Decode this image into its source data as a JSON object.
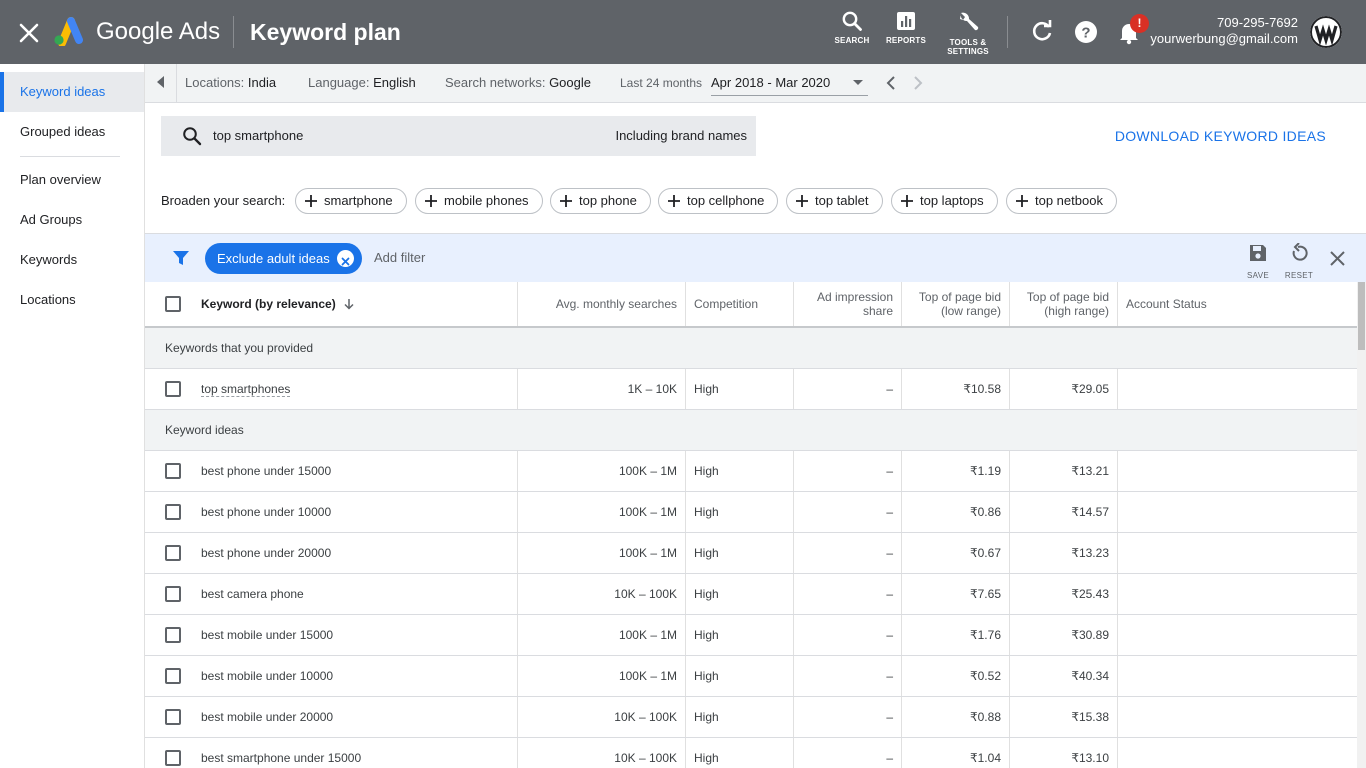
{
  "header": {
    "brand": "Google Ads",
    "page_title": "Keyword plan",
    "tools": [
      {
        "label": "SEARCH",
        "icon": "search-icon"
      },
      {
        "label": "REPORTS",
        "icon": "reports-icon"
      },
      {
        "label": "TOOLS &\nSETTINGS",
        "icon": "wrench-icon"
      }
    ],
    "notification_badge": "!",
    "account_phone": "709-295-7692",
    "account_email": "yourwerbung@gmail.com"
  },
  "sidebar": {
    "items": [
      {
        "label": "Keyword ideas",
        "active": true
      },
      {
        "label": "Grouped ideas"
      },
      {
        "label": "Plan overview"
      },
      {
        "label": "Ad Groups"
      },
      {
        "label": "Keywords"
      },
      {
        "label": "Locations"
      }
    ]
  },
  "strip": {
    "locations_label": "Locations:",
    "locations_value": "India",
    "language_label": "Language:",
    "language_value": "English",
    "networks_label": "Search networks:",
    "networks_value": "Google",
    "period_label": "Last 24 months",
    "date_range": "Apr 2018 - Mar 2020"
  },
  "search": {
    "query": "top smartphone",
    "brand_note": "Including brand names",
    "download_label": "DOWNLOAD KEYWORD IDEAS",
    "broaden_label": "Broaden your search:",
    "broaden_chips": [
      "smartphone",
      "mobile phones",
      "top phone",
      "top cellphone",
      "top tablet",
      "top laptops",
      "top netbook"
    ]
  },
  "filterbar": {
    "exclude_label": "Exclude adult ideas",
    "add_filter_label": "Add filter",
    "save_label": "SAVE",
    "reset_label": "RESET"
  },
  "table": {
    "headers": {
      "keyword": "Keyword (by relevance)",
      "searches": "Avg. monthly searches",
      "competition": "Competition",
      "impression": "Ad impression share",
      "bid_low": "Top of page bid (low range)",
      "bid_high": "Top of page bid (high range)",
      "status": "Account Status"
    },
    "section_provided": "Keywords that you provided",
    "provided_rows": [
      {
        "keyword": "top smartphones",
        "searches": "1K – 10K",
        "competition": "High",
        "impression": "–",
        "bid_low": "₹10.58",
        "bid_high": "₹29.05",
        "status": ""
      }
    ],
    "section_ideas": "Keyword ideas",
    "idea_rows": [
      {
        "keyword": "best phone under 15000",
        "searches": "100K – 1M",
        "competition": "High",
        "impression": "–",
        "bid_low": "₹1.19",
        "bid_high": "₹13.21",
        "status": ""
      },
      {
        "keyword": "best phone under 10000",
        "searches": "100K – 1M",
        "competition": "High",
        "impression": "–",
        "bid_low": "₹0.86",
        "bid_high": "₹14.57",
        "status": ""
      },
      {
        "keyword": "best phone under 20000",
        "searches": "100K – 1M",
        "competition": "High",
        "impression": "–",
        "bid_low": "₹0.67",
        "bid_high": "₹13.23",
        "status": ""
      },
      {
        "keyword": "best camera phone",
        "searches": "10K – 100K",
        "competition": "High",
        "impression": "–",
        "bid_low": "₹7.65",
        "bid_high": "₹25.43",
        "status": ""
      },
      {
        "keyword": "best mobile under 15000",
        "searches": "100K – 1M",
        "competition": "High",
        "impression": "–",
        "bid_low": "₹1.76",
        "bid_high": "₹30.89",
        "status": ""
      },
      {
        "keyword": "best mobile under 10000",
        "searches": "100K – 1M",
        "competition": "High",
        "impression": "–",
        "bid_low": "₹0.52",
        "bid_high": "₹40.34",
        "status": ""
      },
      {
        "keyword": "best mobile under 20000",
        "searches": "10K – 100K",
        "competition": "High",
        "impression": "–",
        "bid_low": "₹0.88",
        "bid_high": "₹15.38",
        "status": ""
      },
      {
        "keyword": "best smartphone under 15000",
        "searches": "10K – 100K",
        "competition": "High",
        "impression": "–",
        "bid_low": "₹1.04",
        "bid_high": "₹13.10",
        "status": ""
      }
    ]
  },
  "colors": {
    "topbar": "#5f6368",
    "accent": "#1a73e8",
    "filterbar_bg": "#e8f0fe",
    "badge": "#d93025"
  }
}
